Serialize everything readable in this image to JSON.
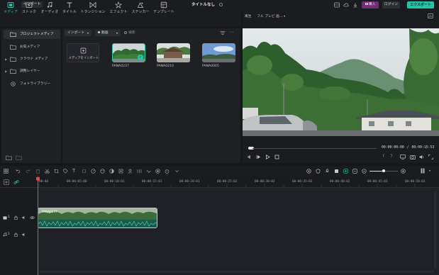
{
  "topbar": {
    "import_label": "インポート",
    "title": "タイトルなし",
    "purchase_label": "購入",
    "login_label": "ログイン",
    "export_label": "エクスポート"
  },
  "toolbar": {
    "tabs": [
      {
        "label": "メディア",
        "icon": "media-icon"
      },
      {
        "label": "ストック",
        "icon": "stock-icon"
      },
      {
        "label": "オーディオ",
        "icon": "audio-icon"
      },
      {
        "label": "タイトル",
        "icon": "title-icon"
      },
      {
        "label": "トランジション",
        "icon": "transition-icon"
      },
      {
        "label": "エフェクト",
        "icon": "effect-icon"
      },
      {
        "label": "ステッカー",
        "icon": "sticker-icon"
      },
      {
        "label": "テンプレート",
        "icon": "template-icon"
      }
    ]
  },
  "sidebar": {
    "items": [
      {
        "label": "プロジェクトメディア"
      },
      {
        "label": "お気メディア"
      },
      {
        "label": "クラウド メディア"
      },
      {
        "label": "調整レイヤー"
      },
      {
        "label": "フォトライブラリー"
      }
    ]
  },
  "media": {
    "import_dropdown": "インポート",
    "type_dropdown": "動画",
    "search_placeholder": "検索",
    "import_tile_label": "メディアをインポート",
    "items": [
      {
        "name": "PANA0237"
      },
      {
        "name": "PANA0210"
      },
      {
        "name": "PANA0005"
      }
    ]
  },
  "preview": {
    "mode_label": "再生",
    "quality_label": "フル プレビ  画...",
    "current_time": "00:00:00:00",
    "separator": "/",
    "total_time": "00:00:15:53"
  },
  "timeline": {
    "timecodes": [
      "00:00",
      "00:00:05:00",
      "00:00:10:01",
      "00:00:15:01",
      "00:00:20:01",
      "00:00:25:02",
      "00:00:30:02",
      "00:00:35:02",
      "00:00:40:02",
      "00:00:45:03",
      "00:00:50:03"
    ],
    "video_track_label": "1",
    "audio_track_label": "1",
    "clip_name": "PANA0237"
  },
  "colors": {
    "accent": "#23c5a6",
    "purchase": "#6e2f77",
    "playhead": "#e04848",
    "background": "#16171b"
  }
}
